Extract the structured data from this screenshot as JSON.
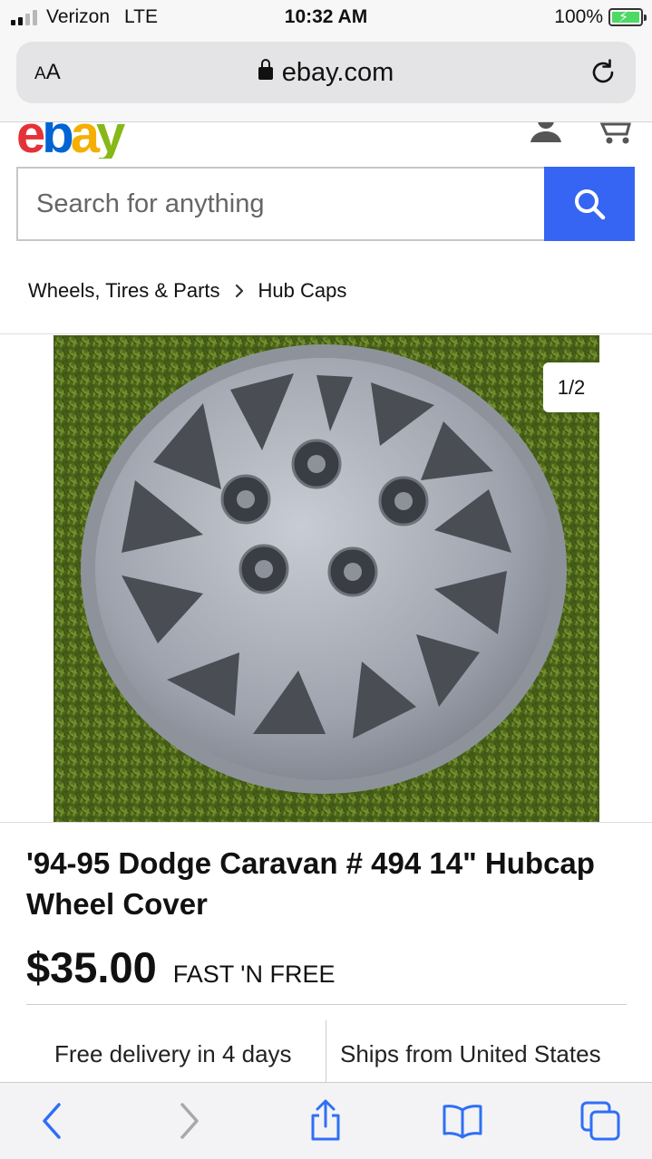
{
  "status_bar": {
    "carrier": "Verizon",
    "network": "LTE",
    "time": "10:32 AM",
    "battery": "100%",
    "icons": [
      "signal-icon",
      "battery-charging-icon"
    ]
  },
  "browser": {
    "text_size_label": "AA",
    "url": "ebay.com",
    "icons": [
      "lock-icon",
      "reload-icon"
    ]
  },
  "site": {
    "logo_text": [
      "e",
      "b",
      "a",
      "y"
    ],
    "logo_colors": [
      "#e53238",
      "#0064d2",
      "#f5af02",
      "#86b817"
    ],
    "icons": [
      "account-icon",
      "cart-icon"
    ]
  },
  "search": {
    "placeholder": "Search for anything",
    "button_color": "#3665f3",
    "icon": "search-icon"
  },
  "breadcrumb": {
    "items": [
      "Wheels, Tires & Parts",
      "Hub Caps"
    ],
    "separator_icon": "chevron-right-icon"
  },
  "gallery": {
    "counter": "1/2",
    "image_subject": "hubcap-photo"
  },
  "listing": {
    "title": "'94-95 Dodge Caravan # 494 14\" Hubcap Wheel Cover",
    "price": "$35.00",
    "shipping_badge": "FAST 'N FREE",
    "delivery": "Free delivery in 4 days",
    "ships_from": "Ships from United States"
  },
  "toolbar": {
    "icons": [
      "back-icon",
      "forward-icon",
      "share-icon",
      "bookmarks-icon",
      "tabs-icon"
    ]
  }
}
